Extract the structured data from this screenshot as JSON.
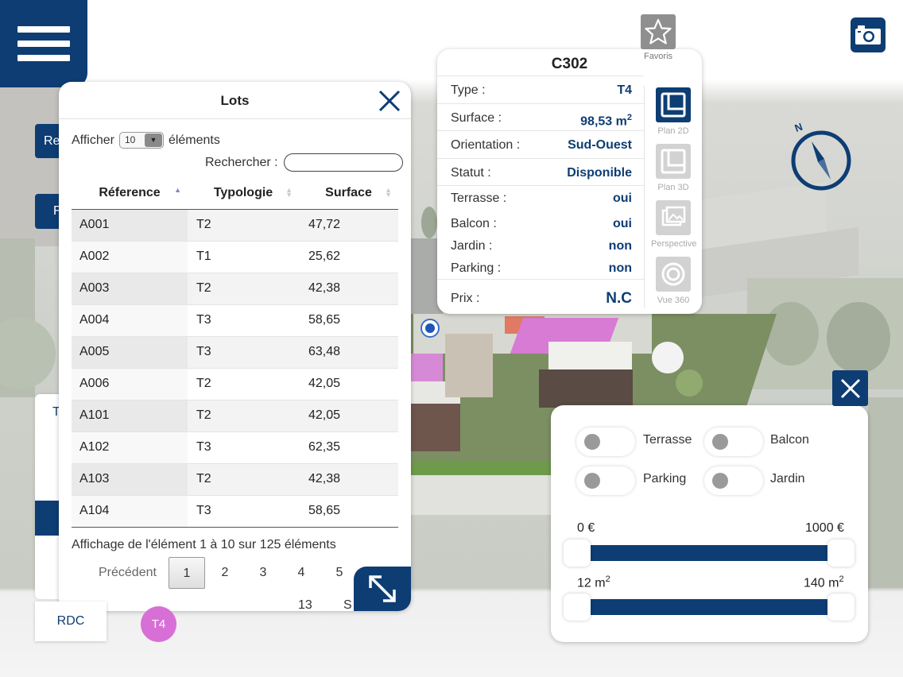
{
  "colors": {
    "brand": "#0d3d73",
    "accent_value": "#0d3d73",
    "badge_t4": "#d86fd6"
  },
  "side_buttons": {
    "top_partial": "Re",
    "second_partial": "F",
    "panel_partial": "T"
  },
  "lots_panel": {
    "title": "Lots",
    "show_prefix": "Afficher",
    "show_value": "10",
    "show_suffix": "éléments",
    "search_label": "Rechercher :",
    "search_value": "",
    "columns": [
      "Réference",
      "Typologie",
      "Surface"
    ],
    "rows": [
      {
        "ref": "A001",
        "type": "T2",
        "surface": "47,72"
      },
      {
        "ref": "A002",
        "type": "T1",
        "surface": "25,62"
      },
      {
        "ref": "A003",
        "type": "T2",
        "surface": "42,38"
      },
      {
        "ref": "A004",
        "type": "T3",
        "surface": "58,65"
      },
      {
        "ref": "A005",
        "type": "T3",
        "surface": "63,48"
      },
      {
        "ref": "A006",
        "type": "T2",
        "surface": "42,05"
      },
      {
        "ref": "A101",
        "type": "T2",
        "surface": "42,05"
      },
      {
        "ref": "A102",
        "type": "T3",
        "surface": "62,35"
      },
      {
        "ref": "A103",
        "type": "T2",
        "surface": "42,38"
      },
      {
        "ref": "A104",
        "type": "T3",
        "surface": "58,65"
      }
    ],
    "info": "Affichage de l'élément 1 à 10 sur 125 éléments",
    "pagination": {
      "previous": "Précédent",
      "pages": [
        "1",
        "2",
        "3",
        "4",
        "5"
      ],
      "current": "1",
      "extra_page": "13",
      "next_partial": "S"
    }
  },
  "lot_card": {
    "title": "C302",
    "type_label": "Type :",
    "type_value": "T4",
    "surface_label": "Surface :",
    "surface_value": "98,53 m",
    "surface_unit_sup": "2",
    "orientation_label": "Orientation :",
    "orientation_value": "Sud-Ouest",
    "status_label": "Statut :",
    "status_value": "Disponible",
    "terrace_label": "Terrasse :",
    "terrace_value": "oui",
    "balcony_label": "Balcon :",
    "balcony_value": "oui",
    "garden_label": "Jardin :",
    "garden_value": "non",
    "parking_label": "Parking :",
    "parking_value": "non",
    "price_label": "Prix :",
    "price_value": "N.C"
  },
  "tools": {
    "favorites": "Favoris",
    "plan2d": "Plan 2D",
    "plan3d": "Plan 3D",
    "perspective": "Perspective",
    "vue360": "Vue 360"
  },
  "filters": {
    "toggles": [
      {
        "label": "Terrasse",
        "on": false
      },
      {
        "label": "Balcon",
        "on": false
      },
      {
        "label": "Parking",
        "on": false
      },
      {
        "label": "Jardin",
        "on": false
      }
    ],
    "price": {
      "min_label": "0 €",
      "max_label": "1000 €",
      "min": 0,
      "max": 1000
    },
    "surface": {
      "min_label": "12 m",
      "max_label": "140 m",
      "unit_sup": "2",
      "min": 12,
      "max": 140
    }
  },
  "floor_button": "RDC",
  "typology_badge": "T4"
}
